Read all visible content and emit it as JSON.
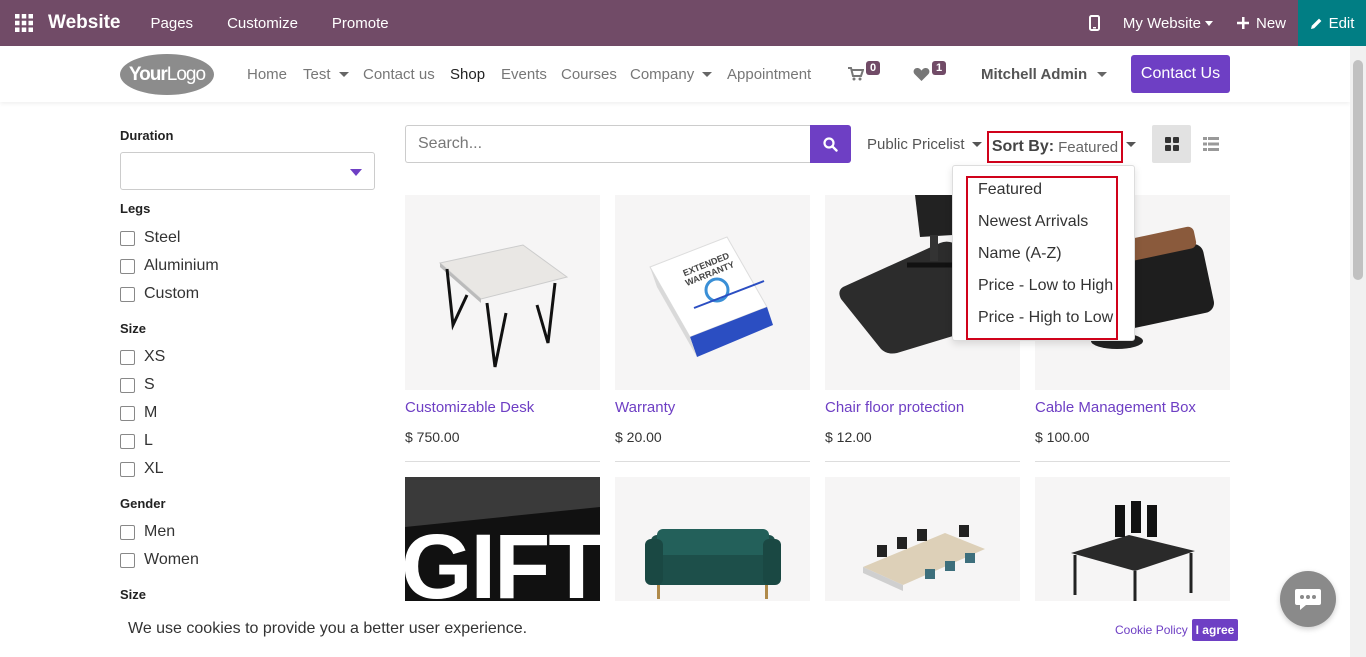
{
  "adminbar": {
    "brand": "Website",
    "menus": [
      "Pages",
      "Customize",
      "Promote"
    ],
    "site_selector": "My Website",
    "new_label": "New",
    "edit_label": "Edit",
    "color": "#714B67",
    "edit_color": "#017E84"
  },
  "header": {
    "logo_bold": "Your",
    "logo_thin": "Logo",
    "nav": {
      "home": "Home",
      "test": "Test",
      "contact": "Contact us",
      "shop": "Shop",
      "events": "Events",
      "courses": "Courses",
      "company": "Company",
      "appointment": "Appointment"
    },
    "cart_count": "0",
    "wishlist_count": "1",
    "user": "Mitchell Admin",
    "contact_button": "Contact Us",
    "accent": "#6E3FC4"
  },
  "sidebar": {
    "duration_title": "Duration",
    "legs_title": "Legs",
    "legs": [
      "Steel",
      "Aluminium",
      "Custom"
    ],
    "size_title": "Size",
    "sizes": [
      "XS",
      "S",
      "M",
      "L",
      "XL"
    ],
    "gender_title": "Gender",
    "genders": [
      "Men",
      "Women"
    ],
    "size2_title": "Size"
  },
  "toolbar": {
    "search_placeholder": "Search...",
    "pricelist": "Public Pricelist",
    "sort_label": "Sort By:",
    "sort_value": "Featured"
  },
  "sort_options": [
    "Featured",
    "Newest Arrivals",
    "Name (A-Z)",
    "Price - Low to High",
    "Price - High to Low"
  ],
  "products": [
    {
      "name": "Customizable Desk",
      "price": "$ 750.00"
    },
    {
      "name": "Warranty",
      "price": "$ 20.00"
    },
    {
      "name": "Chair floor protection",
      "price": "$ 12.00"
    },
    {
      "name": "Cable Management Box",
      "price": "$ 100.00"
    }
  ],
  "gift_text": "GIFT",
  "warranty_text": "EXTENDED WARRANTY",
  "cookie": {
    "text": "We use cookies to provide you a better user experience.",
    "policy": "Cookie Policy",
    "agree": "I agree"
  }
}
